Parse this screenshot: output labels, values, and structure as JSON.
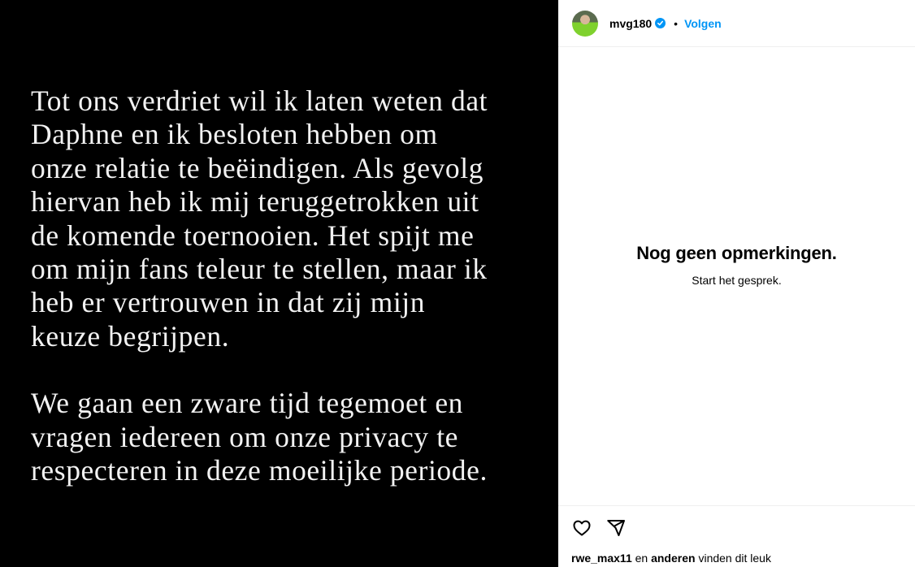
{
  "media": {
    "paragraphs": [
      [
        "Tot ons verdriet wil ik laten weten dat",
        "Daphne en ik besloten hebben om",
        "onze relatie te beëindigen. Als gevolg",
        "hiervan heb ik mij teruggetrokken uit",
        "de komende toernooien. Het spijt me",
        "om mijn fans teleur te stellen, maar ik",
        "heb er vertrouwen in dat zij mijn",
        "keuze begrijpen."
      ],
      [
        "We gaan een zware tijd tegemoet en",
        "vragen iedereen om onze privacy te",
        "respecteren in deze moeilijke periode."
      ]
    ]
  },
  "header": {
    "username": "mvg180",
    "separator": "•",
    "follow_label": "Volgen"
  },
  "comments": {
    "empty_title": "Nog geen opmerkingen.",
    "empty_subtitle": "Start het gesprek."
  },
  "likes": {
    "user": "rwe_max11",
    "connector": "en",
    "others": "anderen",
    "suffix": "vinden dit leuk"
  },
  "colors": {
    "accent": "#0095f6",
    "media_bg": "#000000",
    "media_text": "#f2f2f2",
    "divider": "#efefef"
  },
  "icons": [
    "verified-badge-icon",
    "heart-icon",
    "share-icon"
  ]
}
